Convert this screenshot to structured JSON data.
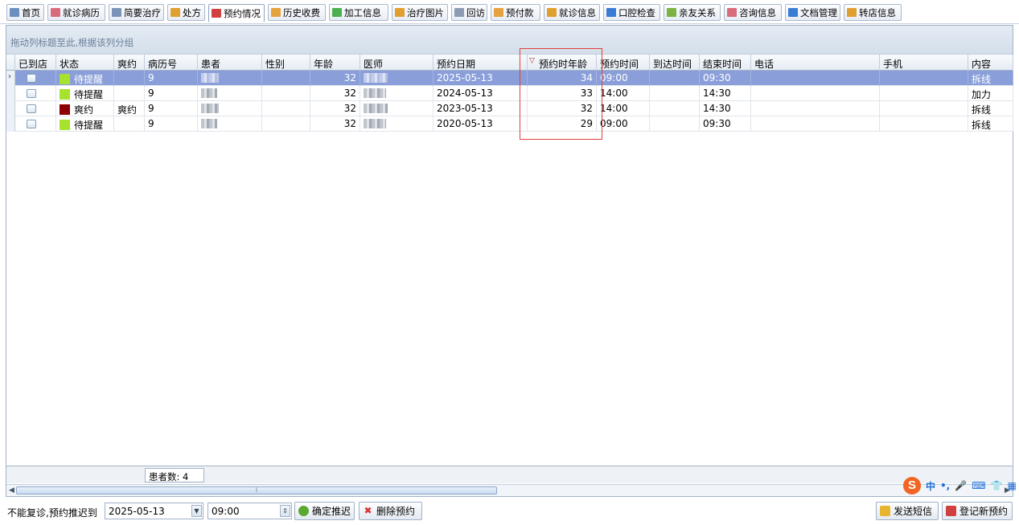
{
  "tabs": [
    {
      "label": "首页",
      "icon": "home-icon",
      "color": "#6b8fbf"
    },
    {
      "label": "就诊病历",
      "icon": "record-icon",
      "color": "#d96b7a"
    },
    {
      "label": "简要治疗",
      "icon": "list-icon",
      "color": "#7a93b8"
    },
    {
      "label": "处方",
      "icon": "pill-icon",
      "color": "#e0a030"
    },
    {
      "label": "预约情况",
      "icon": "calendar-icon",
      "color": "#d04040"
    },
    {
      "label": "历史收费",
      "icon": "money-icon",
      "color": "#e6a23c"
    },
    {
      "label": "加工信息",
      "icon": "process-icon",
      "color": "#4caf50"
    },
    {
      "label": "治疗图片",
      "icon": "image-icon",
      "color": "#e0a030"
    },
    {
      "label": "回访",
      "icon": "revisit-icon",
      "color": "#8a9bb3"
    },
    {
      "label": "预付款",
      "icon": "prepay-icon",
      "color": "#e6a23c"
    },
    {
      "label": "就诊信息",
      "icon": "info-icon",
      "color": "#e0a030"
    },
    {
      "label": "口腔检查",
      "icon": "exam-icon",
      "color": "#3a7bd5"
    },
    {
      "label": "亲友关系",
      "icon": "relation-icon",
      "color": "#7cb342"
    },
    {
      "label": "咨询信息",
      "icon": "consult-icon",
      "color": "#d96b7a"
    },
    {
      "label": "文档管理",
      "icon": "document-icon",
      "color": "#3a7bd5"
    },
    {
      "label": "转店信息",
      "icon": "transfer-icon",
      "color": "#e0a030"
    }
  ],
  "active_tab": "预约情况",
  "group_hint": "拖动列标题至此,根据该列分组",
  "columns": [
    "已到店",
    "状态",
    "爽约",
    "病历号",
    "患者",
    "性别",
    "年龄",
    "医师",
    "预约日期",
    "预约时年龄",
    "预约时间",
    "到达时间",
    "结束时间",
    "电话",
    "手机",
    "内容"
  ],
  "rows": [
    {
      "status": "待提醒",
      "status_color": "#a6e22e",
      "noshow": "",
      "record_no": "9",
      "age": "32",
      "date": "2025-05-13",
      "appt_age": "34",
      "time": "09:00",
      "end": "09:30",
      "content": "拆线"
    },
    {
      "status": "待提醒",
      "status_color": "#a6e22e",
      "noshow": "",
      "record_no": "9",
      "age": "32",
      "date": "2024-05-13",
      "appt_age": "33",
      "time": "14:00",
      "end": "14:30",
      "content": "加力"
    },
    {
      "status": "爽约",
      "status_color": "#8b0000",
      "noshow": "爽约",
      "record_no": "9",
      "age": "32",
      "date": "2023-05-13",
      "appt_age": "32",
      "time": "14:00",
      "end": "14:30",
      "content": "拆线"
    },
    {
      "status": "待提醒",
      "status_color": "#a6e22e",
      "noshow": "",
      "record_no": "9",
      "age": "32",
      "date": "2020-05-13",
      "appt_age": "29",
      "time": "09:00",
      "end": "09:30",
      "content": "拆线"
    }
  ],
  "footer": {
    "patient_count": "患者数: 4"
  },
  "bottom": {
    "label": "不能复诊,预约推迟到",
    "date_value": "2025-05-13",
    "time_value": "09:00",
    "confirm_label": "确定推迟",
    "delete_label": "删除预约",
    "sms_label": "发送短信",
    "new_label": "登记新预约"
  },
  "ime": {
    "logo": "S",
    "mode": "中"
  }
}
